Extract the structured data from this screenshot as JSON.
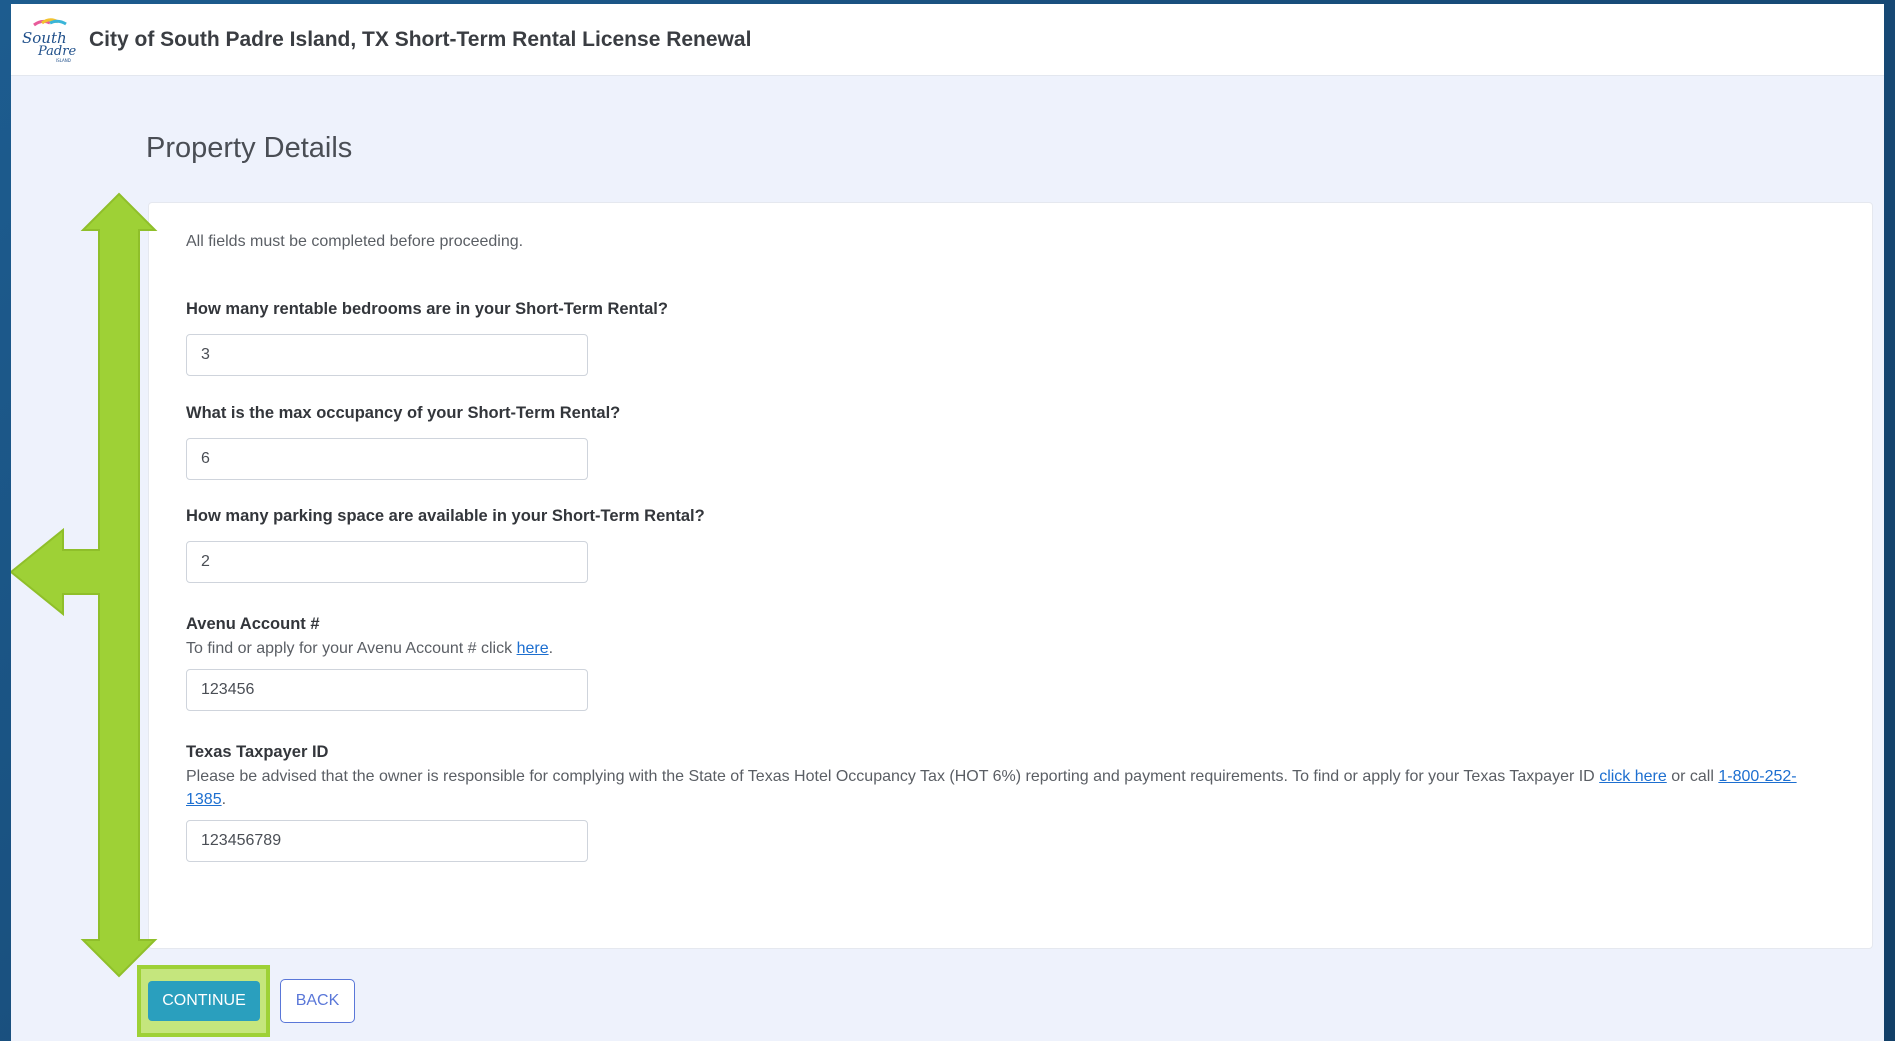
{
  "header": {
    "title": "City of South Padre Island, TX Short-Term Rental License Renewal",
    "logo_icon": "south-padre-island-logo"
  },
  "page": {
    "title": "Property Details",
    "intro": "All fields must be completed before proceeding."
  },
  "fields": {
    "bedrooms": {
      "label": "How many rentable bedrooms are in your Short-Term Rental?",
      "value": "3"
    },
    "occupancy": {
      "label": "What is the max occupancy of your Short-Term Rental?",
      "value": "6"
    },
    "parking": {
      "label": "How many parking space are available in your Short-Term Rental?",
      "value": "2"
    },
    "avenu": {
      "label": "Avenu Account #",
      "help_prefix": "To find or apply for your Avenu Account # click ",
      "help_link": "here",
      "help_suffix": ".",
      "value": "123456"
    },
    "taxpayer": {
      "label": "Texas Taxpayer ID",
      "help_prefix": "Please be advised that the owner is responsible for complying with the State of Texas Hotel Occupancy Tax (HOT 6%) reporting and payment requirements. To find or apply for your Texas Taxpayer ID ",
      "help_link": "click here",
      "help_middle": " or call ",
      "help_phone": "1-800-252-1385",
      "help_suffix": ".",
      "value": "123456789"
    }
  },
  "actions": {
    "continue_label": "CONTINUE",
    "back_label": "BACK"
  },
  "annotations": {
    "arrow_color": "#9ed136",
    "arrow_icon": "scroll-direction-arrow-icon"
  }
}
